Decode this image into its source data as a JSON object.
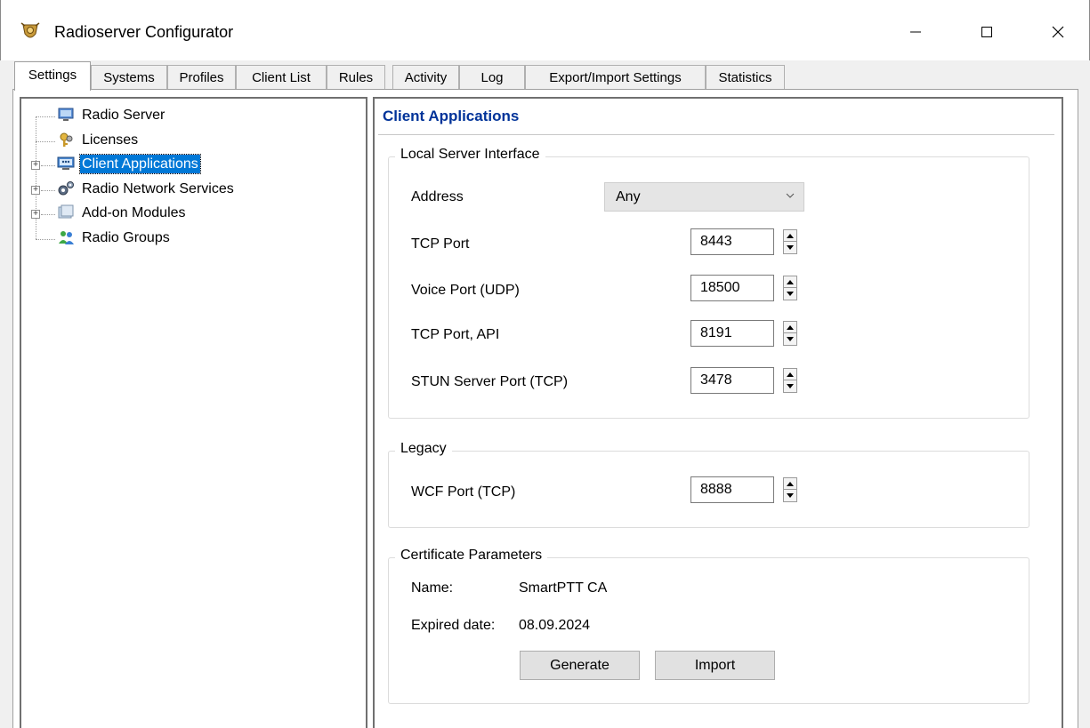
{
  "window": {
    "title": "Radioserver Configurator"
  },
  "tabs": [
    {
      "label": "Settings"
    },
    {
      "label": "Systems"
    },
    {
      "label": "Profiles"
    },
    {
      "label": "Client List"
    },
    {
      "label": "Rules"
    },
    {
      "label": "Activity"
    },
    {
      "label": "Log"
    },
    {
      "label": "Export/Import Settings"
    },
    {
      "label": "Statistics"
    }
  ],
  "active_tab": "Settings",
  "tree": {
    "items": [
      {
        "label": "Radio Server",
        "icon": "monitor-icon",
        "expandable": false
      },
      {
        "label": "Licenses",
        "icon": "keys-icon",
        "expandable": false
      },
      {
        "label": "Client Applications",
        "icon": "network-computer-icon",
        "expandable": true,
        "selected": true
      },
      {
        "label": "Radio Network Services",
        "icon": "gears-icon",
        "expandable": true
      },
      {
        "label": "Add-on Modules",
        "icon": "modules-icon",
        "expandable": true
      },
      {
        "label": "Radio Groups",
        "icon": "users-icon",
        "expandable": false
      }
    ]
  },
  "panel": {
    "title": "Client Applications",
    "local_server": {
      "legend": "Local Server Interface",
      "address_label": "Address",
      "address_value": "Any",
      "tcp_port_label": "TCP Port",
      "tcp_port_value": "8443",
      "voice_port_label": "Voice Port (UDP)",
      "voice_port_value": "18500",
      "api_port_label": "TCP Port, API",
      "api_port_value": "8191",
      "stun_port_label": "STUN Server Port (TCP)",
      "stun_port_value": "3478"
    },
    "legacy": {
      "legend": "Legacy",
      "wcf_port_label": "WCF Port (TCP)",
      "wcf_port_value": "8888"
    },
    "certificate": {
      "legend": "Certificate Parameters",
      "name_label": "Name:",
      "name_value": "SmartPTT CA",
      "expired_label": "Expired date:",
      "expired_value": "08.09.2024",
      "generate_label": "Generate",
      "import_label": "Import"
    }
  },
  "colors": {
    "selection": "#0078d7",
    "section_title": "#003399"
  }
}
